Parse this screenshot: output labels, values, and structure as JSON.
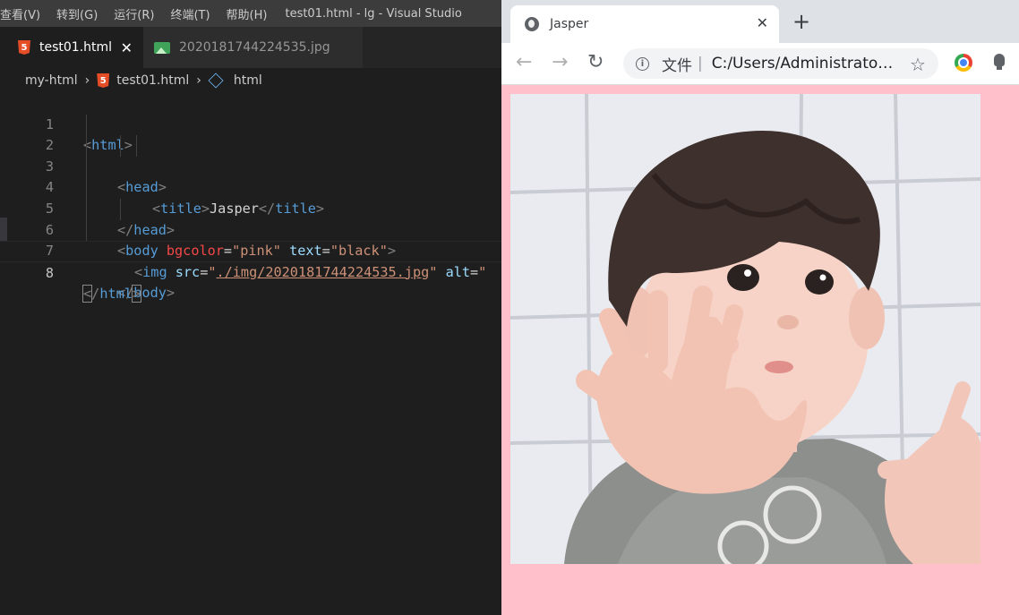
{
  "vscode": {
    "menu": [
      "查看(V)",
      "转到(G)",
      "运行(R)",
      "终端(T)",
      "帮助(H)"
    ],
    "window_title": "test01.html - lg - Visual Studio",
    "tabs": [
      {
        "label": "test01.html",
        "icon": "html5-icon"
      },
      {
        "label": "2020181744224535.jpg",
        "icon": "image-file-icon"
      }
    ],
    "breadcrumb": [
      "my-html",
      "test01.html",
      "html"
    ],
    "line_numbers": [
      "1",
      "2",
      "3",
      "4",
      "5",
      "6",
      "7",
      "8"
    ],
    "current_line": "8",
    "code": {
      "html_tag": "html",
      "head_tag": "head",
      "title_tag": "title",
      "title_text": "Jasper",
      "body_tag": "body",
      "bgcolor_attr": "bgcolor",
      "bgcolor_value": "\"pink\"",
      "text_attr": "text",
      "text_value": "\"black\"",
      "img_tag": "img",
      "src_attr": "src",
      "src_value": "./img/2020181744224535.jpg",
      "alt_attr": "alt"
    }
  },
  "chrome": {
    "tab_title": "Jasper",
    "address_label": "文件",
    "address_sep": "|",
    "url": "C:/Users/Administrato…",
    "page_background": "#ffc0cb",
    "image_content": "photo of toddler with raised hands"
  },
  "colors": {
    "editor_bg": "#1e1e1e",
    "tag": "#569cd6",
    "attribute": "#9cdcfe",
    "string": "#ce9178",
    "pink": "#ffc0cb"
  }
}
